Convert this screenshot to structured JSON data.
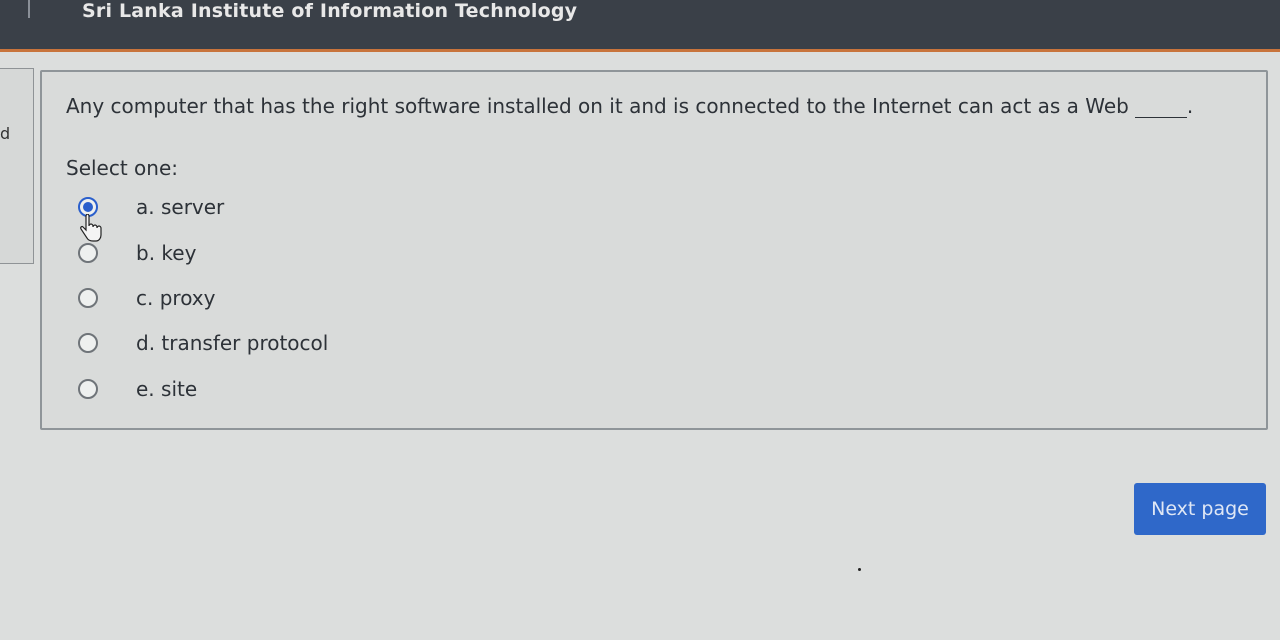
{
  "header": {
    "site_title": "Sri Lanka Institute of Information Technology"
  },
  "side": {
    "mark": "d"
  },
  "question": {
    "text": "Any computer that has the right software installed on it and is connected to the Internet can act as a Web",
    "prompt": "Select one:",
    "options": [
      {
        "label": "a. server",
        "selected": true
      },
      {
        "label": "b. key",
        "selected": false
      },
      {
        "label": "c. proxy",
        "selected": false
      },
      {
        "label": "d. transfer protocol",
        "selected": false
      },
      {
        "label": "e. site",
        "selected": false
      }
    ]
  },
  "nav": {
    "next_label": "Next page"
  },
  "colors": {
    "header_bg": "#3a4048",
    "accent": "#2f68c9",
    "header_border": "#c8743c"
  },
  "icons": {
    "cursor": "hand-pointer-icon"
  }
}
